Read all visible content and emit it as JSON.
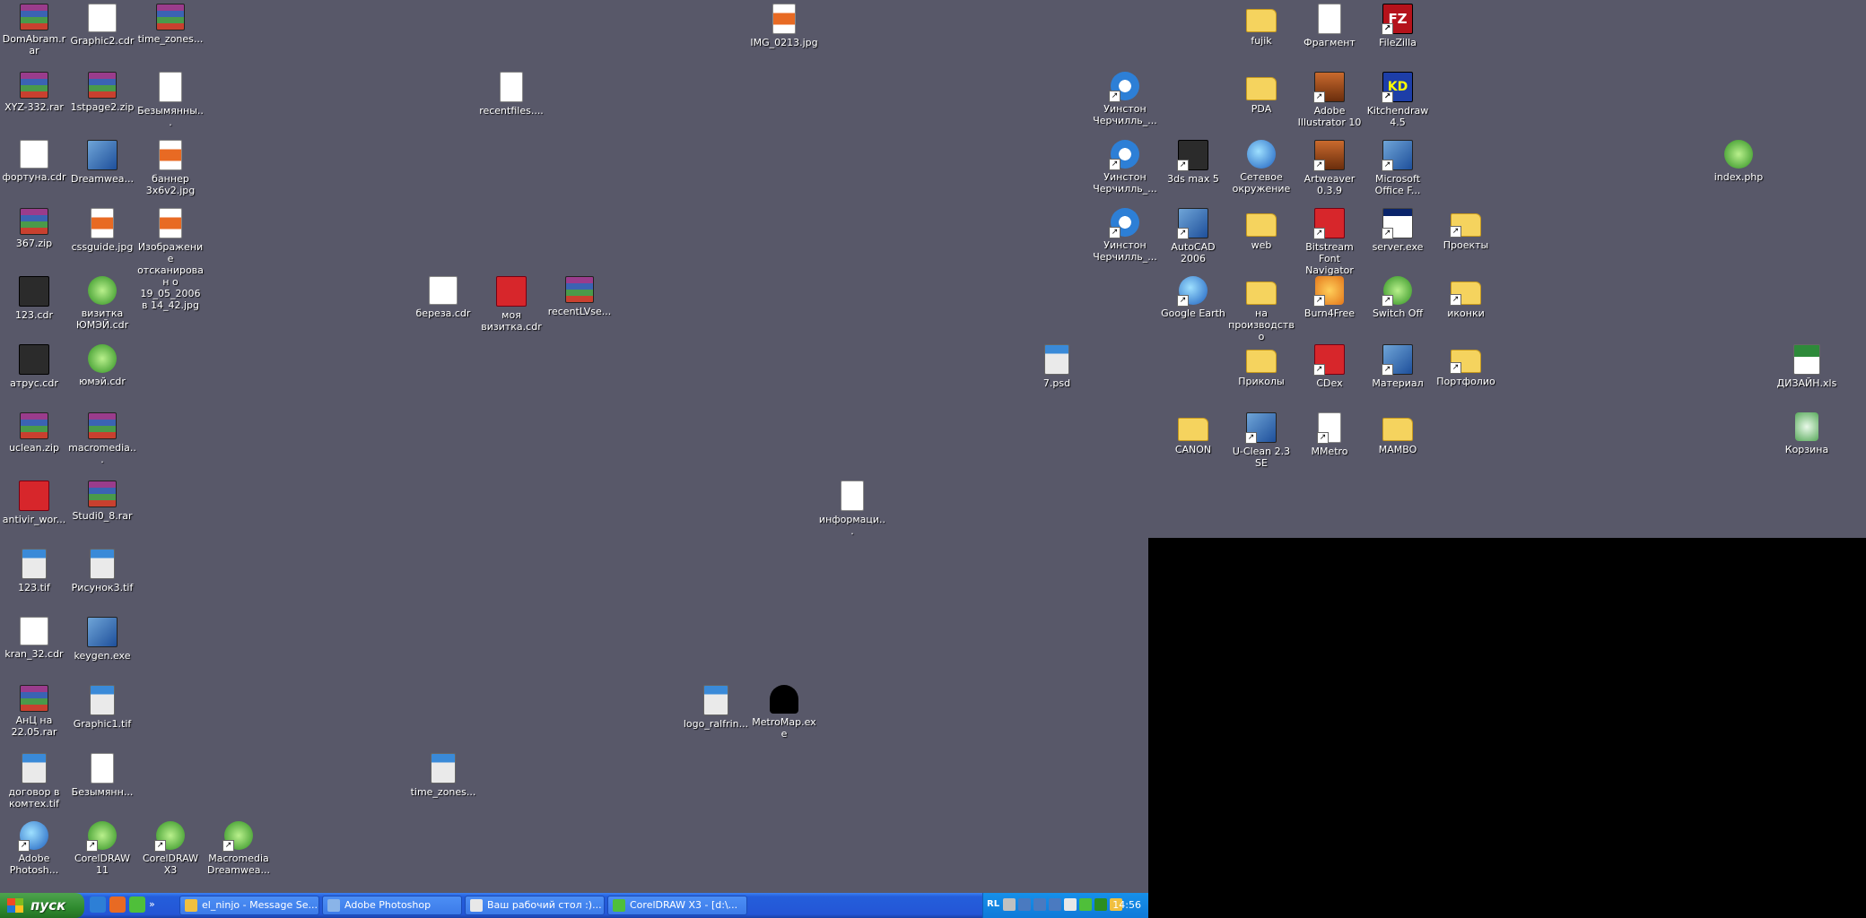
{
  "desktop": {
    "icons": [
      {
        "label": "DomAbram.rar",
        "kind": "rar",
        "shortcut": false
      },
      {
        "label": "Graphic2.cdr",
        "kind": "cdr",
        "shortcut": false
      },
      {
        "label": "time_zones...",
        "kind": "rar",
        "shortcut": false
      },
      {
        "label": "IMG_0213.jpg",
        "kind": "jpg",
        "shortcut": false
      },
      {
        "label": "fujik",
        "kind": "folder",
        "shortcut": false
      },
      {
        "label": "Фрагмент",
        "kind": "doc",
        "shortcut": false
      },
      {
        "label": "FileZilla",
        "kind": "fz",
        "shortcut": true
      },
      {
        "label": "XYZ-332.rar",
        "kind": "rar",
        "shortcut": false
      },
      {
        "label": "1stpage2.zip",
        "kind": "rar",
        "shortcut": false
      },
      {
        "label": "Безымянны...",
        "kind": "doc",
        "shortcut": false
      },
      {
        "label": "recentfiles....",
        "kind": "doc",
        "shortcut": false
      },
      {
        "label": "Уинстон Черчилль_...",
        "kind": "ie",
        "shortcut": true
      },
      {
        "label": "PDA",
        "kind": "folder",
        "shortcut": false
      },
      {
        "label": "Adobe Illustrator 10",
        "kind": "ai",
        "shortcut": true
      },
      {
        "label": "Kitchendraw 4.5",
        "kind": "kd",
        "shortcut": true
      },
      {
        "label": "фортуна.cdr",
        "kind": "cdr",
        "shortcut": false
      },
      {
        "label": "Dreamwea...",
        "kind": "app",
        "shortcut": false
      },
      {
        "label": "баннер 3х6v2.jpg",
        "kind": "jpg",
        "shortcut": false
      },
      {
        "label": "Уинстон Черчилль_...",
        "kind": "ie",
        "shortcut": true
      },
      {
        "label": "3ds max 5",
        "kind": "dark",
        "shortcut": true
      },
      {
        "label": "Сетевое окружение",
        "kind": "globe",
        "shortcut": false
      },
      {
        "label": "Artweaver 0.3.9",
        "kind": "ai",
        "shortcut": true
      },
      {
        "label": "Microsoft Office F...",
        "kind": "app",
        "shortcut": true
      },
      {
        "label": "index.php",
        "kind": "green",
        "shortcut": false
      },
      {
        "label": "367.zip",
        "kind": "rar",
        "shortcut": false
      },
      {
        "label": "cssguide.jpg",
        "kind": "jpg",
        "shortcut": false
      },
      {
        "label": "Изображение отсканирован о 19_05_2006 в 14_42.jpg",
        "kind": "jpg",
        "shortcut": false
      },
      {
        "label": "Уинстон Черчилль_...",
        "kind": "ie",
        "shortcut": true
      },
      {
        "label": "AutoCAD 2006",
        "kind": "app",
        "shortcut": true
      },
      {
        "label": "web",
        "kind": "folder",
        "shortcut": false
      },
      {
        "label": "Bitstream Font Navigator",
        "kind": "red",
        "shortcut": true
      },
      {
        "label": "server.exe",
        "kind": "exe",
        "shortcut": true
      },
      {
        "label": "Проекты",
        "kind": "folder",
        "shortcut": true
      },
      {
        "label": "123.cdr",
        "kind": "dark",
        "shortcut": false
      },
      {
        "label": "визитка ЮМЭЙ.cdr",
        "kind": "green",
        "shortcut": false
      },
      {
        "label": "береза.cdr",
        "kind": "cdr",
        "shortcut": false
      },
      {
        "label": "моя визитка.cdr",
        "kind": "red",
        "shortcut": false
      },
      {
        "label": "recentLVse...",
        "kind": "rar",
        "shortcut": false
      },
      {
        "label": "Google Earth",
        "kind": "globe",
        "shortcut": true
      },
      {
        "label": "на производство",
        "kind": "folder",
        "shortcut": false
      },
      {
        "label": "Burn4Free",
        "kind": "orange",
        "shortcut": true
      },
      {
        "label": "Switch Off",
        "kind": "green",
        "shortcut": true
      },
      {
        "label": "иконки",
        "kind": "folder",
        "shortcut": true
      },
      {
        "label": "атрус.cdr",
        "kind": "dark",
        "shortcut": false
      },
      {
        "label": "юмэй.cdr",
        "kind": "green",
        "shortcut": false
      },
      {
        "label": "7.psd",
        "kind": "tif",
        "shortcut": false
      },
      {
        "label": "Приколы",
        "kind": "folder",
        "shortcut": false
      },
      {
        "label": "CDex",
        "kind": "red",
        "shortcut": true
      },
      {
        "label": "Материал",
        "kind": "app",
        "shortcut": true
      },
      {
        "label": "Портфолио",
        "kind": "folder",
        "shortcut": true
      },
      {
        "label": "ДИЗАЙН.xls",
        "kind": "xls",
        "shortcut": false
      },
      {
        "label": "uclean.zip",
        "kind": "rar",
        "shortcut": false
      },
      {
        "label": "macromedia...",
        "kind": "rar",
        "shortcut": false
      },
      {
        "label": "CANON",
        "kind": "folder",
        "shortcut": false
      },
      {
        "label": "U-Clean 2.3 SE",
        "kind": "app",
        "shortcut": true
      },
      {
        "label": "MMetro",
        "kind": "doc",
        "shortcut": true
      },
      {
        "label": "MAMBO",
        "kind": "folder",
        "shortcut": false
      },
      {
        "label": "Корзина",
        "kind": "recycle",
        "shortcut": false
      },
      {
        "label": "antivir_wor...",
        "kind": "red",
        "shortcut": false
      },
      {
        "label": "Studi0_8.rar",
        "kind": "rar",
        "shortcut": false
      },
      {
        "label": "информаци...",
        "kind": "doc",
        "shortcut": false
      },
      {
        "label": "123.tif",
        "kind": "tif",
        "shortcut": false
      },
      {
        "label": "Рисунок3.tif",
        "kind": "tif",
        "shortcut": false
      },
      {
        "label": "kran_32.cdr",
        "kind": "cdr",
        "shortcut": false
      },
      {
        "label": "keygen.exe",
        "kind": "app",
        "shortcut": false
      },
      {
        "label": "АнЦ на 22.05.rar",
        "kind": "rar",
        "shortcut": false
      },
      {
        "label": "Graphic1.tif",
        "kind": "tif",
        "shortcut": false
      },
      {
        "label": "logo_ralfrin...",
        "kind": "tif",
        "shortcut": false
      },
      {
        "label": "MetroMap.exe",
        "kind": "metro",
        "shortcut": false
      },
      {
        "label": "договор в комтех.tif",
        "kind": "tif",
        "shortcut": false
      },
      {
        "label": "Безымянн...",
        "kind": "doc",
        "shortcut": false
      },
      {
        "label": "time_zones...",
        "kind": "tif",
        "shortcut": false
      },
      {
        "label": "Adobe Photosh...",
        "kind": "globe",
        "shortcut": true
      },
      {
        "label": "CorelDRAW 11",
        "kind": "green",
        "shortcut": true
      },
      {
        "label": "CorelDRAW X3",
        "kind": "green",
        "shortcut": true
      },
      {
        "label": "Macromedia Dreamwea...",
        "kind": "green",
        "shortcut": true
      }
    ]
  },
  "taskbar": {
    "start_label": "пуск",
    "quick_launch": [
      {
        "icon": "ie-icon",
        "color": "#2d7fd6"
      },
      {
        "icon": "photoshop-icon",
        "color": "#e86a23"
      },
      {
        "icon": "dreamweaver-icon",
        "color": "#4fbf3a"
      }
    ],
    "chevron": "»",
    "tasks": [
      {
        "label": "el_ninjo - Message Se...",
        "icon_color": "#f0c040"
      },
      {
        "label": "Adobe Photoshop",
        "icon_color": "#8ab4e8"
      },
      {
        "label": "Ваш рабочий стол :)...",
        "icon_color": "#e8e8e8"
      },
      {
        "label": "CorelDRAW X3 - [d:\\...",
        "icon_color": "#4fbf3a"
      }
    ],
    "tray": {
      "language": "RL",
      "icons": [
        {
          "icon": "tray-icon",
          "color": "#c0c0c0"
        },
        {
          "icon": "tray-icon",
          "color": "#4a7ac0"
        },
        {
          "icon": "tray-icon",
          "color": "#4a7ac0"
        },
        {
          "icon": "tray-icon",
          "color": "#4a7ac0"
        },
        {
          "icon": "tray-icon",
          "color": "#e8e8e8"
        },
        {
          "icon": "tray-icon",
          "color": "#4fbf3a"
        },
        {
          "icon": "tray-icon",
          "color": "#2c8e20"
        },
        {
          "icon": "tray-icon",
          "color": "#f0c040"
        }
      ],
      "clock": "14:56"
    }
  }
}
